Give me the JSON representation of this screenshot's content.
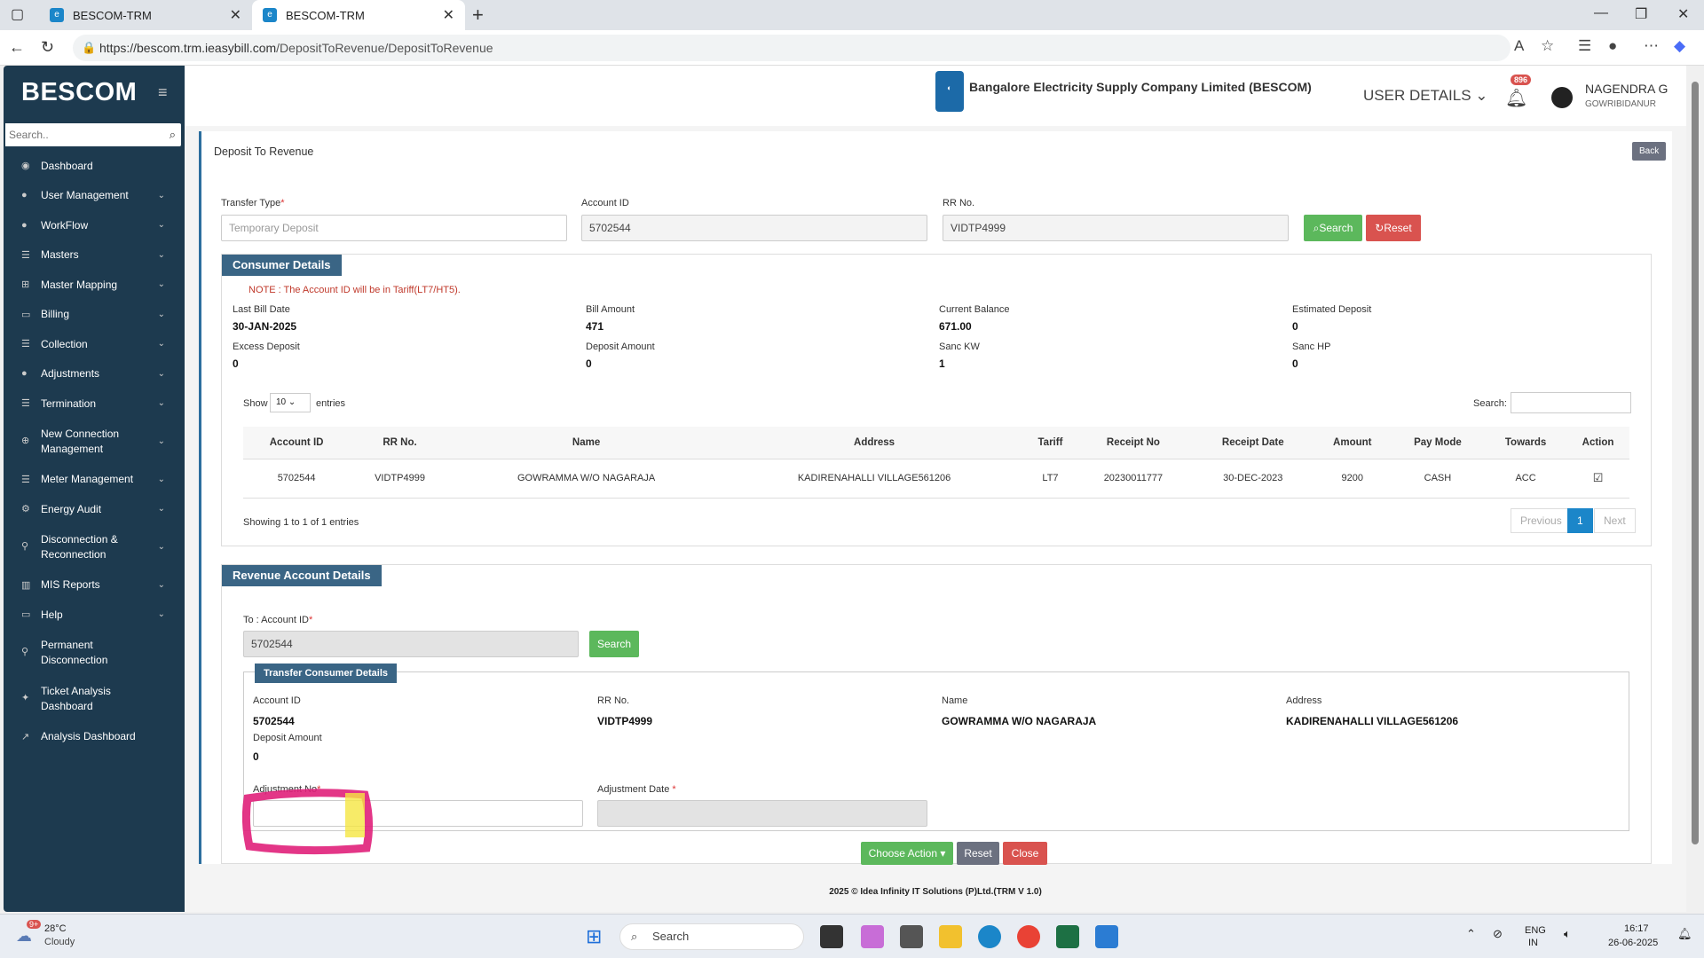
{
  "browser": {
    "tabs": [
      {
        "title": "BESCOM-TRM"
      },
      {
        "title": "BESCOM-TRM"
      }
    ],
    "url_host": "https://bescom.trm.ieasybill.com",
    "url_path": "/DepositToRevenue/DepositToRevenue"
  },
  "sidebar": {
    "logo": "BESCOM",
    "search_placeholder": "Search..",
    "items": [
      {
        "label": "Dashboard",
        "icon": "dashboard-icon",
        "has_submenu": false
      },
      {
        "label": "User Management",
        "icon": "user-icon",
        "has_submenu": true
      },
      {
        "label": "WorkFlow",
        "icon": "user-icon",
        "has_submenu": true
      },
      {
        "label": "Masters",
        "icon": "list-icon",
        "has_submenu": true
      },
      {
        "label": "Master Mapping",
        "icon": "sitemap-icon",
        "has_submenu": true
      },
      {
        "label": "Billing",
        "icon": "monitor-icon",
        "has_submenu": true
      },
      {
        "label": "Collection",
        "icon": "list-icon",
        "has_submenu": true
      },
      {
        "label": "Adjustments",
        "icon": "users-icon",
        "has_submenu": true
      },
      {
        "label": "Termination",
        "icon": "list-icon",
        "has_submenu": true
      },
      {
        "label": "New Connection Management",
        "icon": "plus-circle-icon",
        "has_submenu": true
      },
      {
        "label": "Meter Management",
        "icon": "list-icon",
        "has_submenu": true
      },
      {
        "label": "Energy Audit",
        "icon": "gears-icon",
        "has_submenu": true
      },
      {
        "label": "Disconnection & Reconnection",
        "icon": "link-icon",
        "has_submenu": true
      },
      {
        "label": "MIS Reports",
        "icon": "bar-chart-icon",
        "has_submenu": true
      },
      {
        "label": "Help",
        "icon": "monitor-icon",
        "has_submenu": true
      },
      {
        "label": "Permanent Disconnection",
        "icon": "link-icon",
        "has_submenu": false
      },
      {
        "label": "Ticket Analysis Dashboard",
        "icon": "ticket-icon",
        "has_submenu": false
      },
      {
        "label": "Analysis Dashboard",
        "icon": "line-chart-icon",
        "has_submenu": false
      }
    ]
  },
  "header": {
    "company": "Bangalore Electricity Supply Company Limited (BESCOM)",
    "user_details": "USER DETAILS",
    "notification_count": "896",
    "user_name": "NAGENDRA G",
    "user_location": "GOWRIBIDANUR"
  },
  "page": {
    "title": "Deposit To Revenue",
    "back_label": "Back"
  },
  "search_form": {
    "transfer_type_label": "Transfer Type",
    "transfer_type_value": "Temporary Deposit",
    "account_id_label": "Account ID",
    "account_id_value": "5702544",
    "rr_label": "RR No.",
    "rr_value": "VIDTP4999",
    "search_label": "Search",
    "reset_label": "Reset"
  },
  "consumer": {
    "title": "Consumer Details",
    "note": "NOTE : The Account ID will be in Tariff(LT7/HT5).",
    "fields": [
      {
        "label": "Last Bill Date",
        "value": "30-JAN-2025"
      },
      {
        "label": "Bill Amount",
        "value": "471"
      },
      {
        "label": "Current Balance",
        "value": "671.00"
      },
      {
        "label": "Estimated Deposit",
        "value": "0"
      },
      {
        "label": "Excess Deposit",
        "value": "0"
      },
      {
        "label": "Deposit Amount",
        "value": "0"
      },
      {
        "label": "Sanc KW",
        "value": "1"
      },
      {
        "label": "Sanc HP",
        "value": "0"
      }
    ],
    "show_label": "Show",
    "entries_value": "10",
    "entries_label": "entries",
    "search_label": "Search:",
    "columns": [
      "Account ID",
      "RR No.",
      "Name",
      "Address",
      "Tariff",
      "Receipt No",
      "Receipt Date",
      "Amount",
      "Pay Mode",
      "Towards",
      "Action"
    ],
    "rows": [
      [
        "5702544",
        "VIDTP4999",
        "GOWRAMMA W/O NAGARAJA",
        "KADIRENAHALLI VILLAGE561206",
        "LT7",
        "20230011777",
        "30-DEC-2023",
        "9200",
        "CASH",
        "ACC"
      ]
    ],
    "showing": "Showing 1 to 1 of 1 entries",
    "prev_label": "Previous",
    "page_label": "1",
    "next_label": "Next"
  },
  "revenue": {
    "title": "Revenue Account Details",
    "to_account_label": "To : Account ID",
    "to_account_value": "5702544",
    "search_label": "Search",
    "transfer_title": "Transfer Consumer Details",
    "fields": [
      {
        "label": "Account ID",
        "value": "5702544"
      },
      {
        "label": "RR No.",
        "value": "VIDTP4999"
      },
      {
        "label": "Name",
        "value": "GOWRAMMA W/O NAGARAJA"
      },
      {
        "label": "Address",
        "value": "KADIRENAHALLI VILLAGE561206"
      }
    ],
    "deposit_amount_label": "Deposit Amount",
    "deposit_amount_value": "0",
    "adjustment_no_label": "Adjustment No",
    "adjustment_date_label": "Adjustment Date",
    "choose_action_label": "Choose Action",
    "reset_label": "Reset",
    "close_label": "Close"
  },
  "footer": {
    "text": "2025 © Idea Infinity IT Solutions (P)Ltd.(TRM V 1.0)"
  },
  "taskbar": {
    "weather_temp": "28°C",
    "weather_desc": "Cloudy",
    "weather_badge": "9+",
    "search_label": "Search",
    "lang1": "ENG",
    "lang2": "IN",
    "time": "16:17",
    "date": "26-06-2025"
  },
  "colors": {
    "sidebar": "#1d3a4f",
    "panel_title": "#3a6585",
    "search_green": "#5cb85c",
    "reset_red": "#d9534f",
    "page_blue": "#1b86c9"
  }
}
